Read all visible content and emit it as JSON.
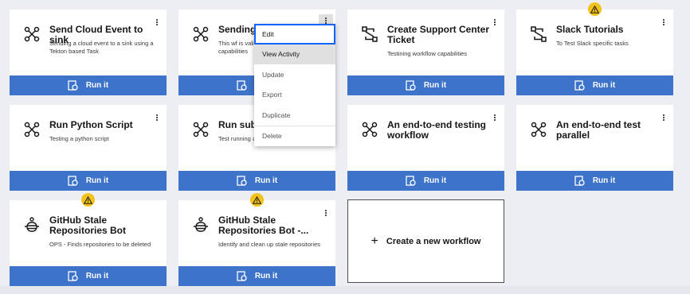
{
  "run_label": "Run it",
  "cards": [
    {
      "title": "Send Cloud Event to sink",
      "desc": "Sending a cloud event to a sink using a Tekton based Task"
    },
    {
      "title": "Sending",
      "desc": "This wf is vali capabilities"
    },
    {
      "title": "Create Support Center Ticket",
      "desc": "Testining workflow capabilities"
    },
    {
      "title": "Slack Tutorials",
      "desc": "To Test Slack specific tasks"
    },
    {
      "title": "Run Python Script",
      "desc": "Testing a python script"
    },
    {
      "title": "Run sub-",
      "desc": "Test running a"
    },
    {
      "title": "An end-to-end testing workflow",
      "desc": ""
    },
    {
      "title": "An end-to-end test parallel",
      "desc": ""
    },
    {
      "title": "GitHub Stale Repositories Bot",
      "desc": "OPS - Finds repositories to be deleted"
    },
    {
      "title": "GitHub Stale Repositories Bot -...",
      "desc": "Identify and clean up stale repositories"
    }
  ],
  "create_workflow_label": "Create a new workflow",
  "menu": {
    "items": [
      "Edit",
      "View Activity",
      "Update",
      "Export",
      "Duplicate",
      "Delete"
    ]
  },
  "icons": {
    "workflow": "workflow-icon",
    "bot": "bot-icon",
    "warning": "warning-icon",
    "run": "run-icon",
    "kebab": "overflow-menu-icon",
    "plus": "plus-icon"
  }
}
